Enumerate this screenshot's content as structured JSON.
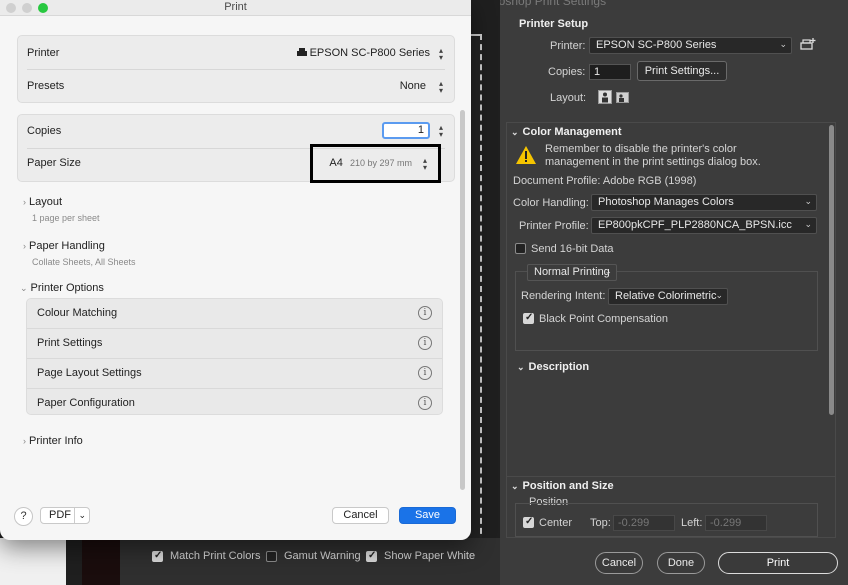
{
  "photoshop": {
    "window_title": "Photoshop Print Settings",
    "printer_setup": {
      "heading": "Printer Setup",
      "printer_label": "Printer:",
      "printer_value": "EPSON SC-P800 Series",
      "copies_label": "Copies:",
      "copies_value": "1",
      "print_settings_button": "Print Settings...",
      "layout_label": "Layout:"
    },
    "color_management": {
      "heading": "Color Management",
      "warning_text": "Remember to disable the printer's color management in the print settings dialog box.",
      "document_profile": "Document Profile: Adobe RGB (1998)",
      "color_handling_label": "Color Handling:",
      "color_handling_value": "Photoshop Manages Colors",
      "printer_profile_label": "Printer Profile:",
      "printer_profile_value": "EP800pkCPF_PLP2880NCA_BPSN.icc",
      "send_16bit_label": "Send 16-bit Data",
      "send_16bit_checked": false,
      "mode_value": "Normal Printing",
      "rendering_intent_label": "Rendering Intent:",
      "rendering_intent_value": "Relative Colorimetric",
      "black_point_label": "Black Point Compensation",
      "black_point_checked": true
    },
    "description_heading": "Description",
    "position_and_size": {
      "heading": "Position and Size",
      "position_label": "Position",
      "center_label": "Center",
      "center_checked": true,
      "top_label": "Top:",
      "top_value": "-0.299",
      "left_label": "Left:",
      "left_value": "-0.299"
    },
    "bottom_checks": {
      "match_print_colors": "Match Print Colors",
      "match_print_colors_checked": true,
      "gamut_warning": "Gamut Warning",
      "gamut_warning_checked": false,
      "show_paper_white": "Show Paper White",
      "show_paper_white_checked": true
    },
    "buttons": {
      "cancel": "Cancel",
      "done": "Done",
      "print": "Print"
    }
  },
  "mac_dialog": {
    "title": "Print",
    "printer_label": "Printer",
    "printer_value": "EPSON SC-P800 Series",
    "presets_label": "Presets",
    "presets_value": "None",
    "copies_label": "Copies",
    "copies_value": "1",
    "paper_size_label": "Paper Size",
    "paper_size_value": "A4",
    "paper_size_dims": "210 by 297 mm",
    "layout": {
      "label": "Layout",
      "summary": "1 page per sheet"
    },
    "paper_handling": {
      "label": "Paper Handling",
      "summary": "Collate Sheets, All Sheets"
    },
    "printer_options": {
      "label": "Printer Options",
      "items": [
        "Colour Matching",
        "Print Settings",
        "Page Layout Settings",
        "Paper Configuration"
      ]
    },
    "printer_info": {
      "label": "Printer Info"
    },
    "help": "?",
    "pdf_button": "PDF",
    "cancel_button": "Cancel",
    "save_button": "Save"
  },
  "colors": {
    "accent_blue": "#1a73e8",
    "traffic_close": "#ff5f57",
    "traffic_min": "#febc2e",
    "traffic_max": "#28c840",
    "warning_yellow": "#f5c400"
  }
}
